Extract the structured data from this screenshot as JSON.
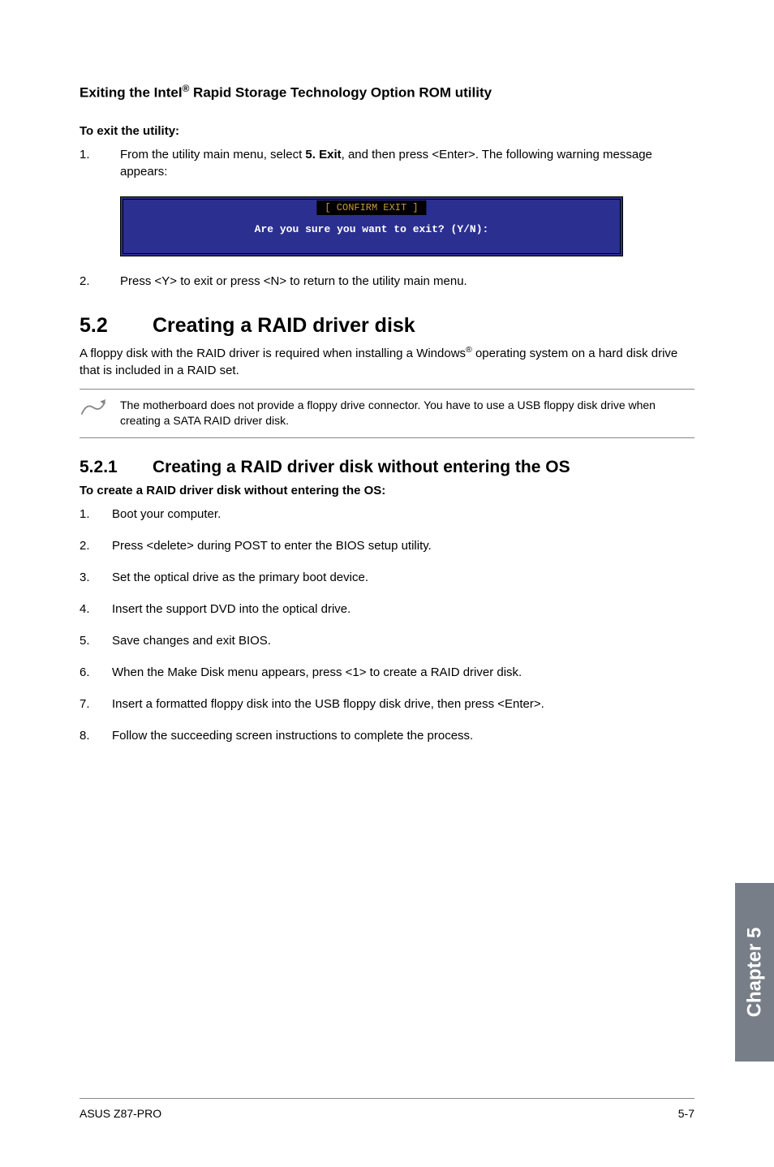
{
  "section1": {
    "heading": "Exiting the Intel",
    "heading_sup": "®",
    "heading_cont": " Rapid Storage Technology Option ROM utility",
    "sub": "To exit the utility:",
    "step1_num": "1.",
    "step1_a": "From the utility main menu, select ",
    "step1_b": "5. Exit",
    "step1_c": ", and then press <Enter>. The following warning message appears:",
    "terminal_header": "[ CONFIRM EXIT ]",
    "terminal_line": "Are you sure you want to exit? (Y/N):",
    "step2_num": "2.",
    "step2": "Press <Y> to exit or press <N> to return to the utility main menu."
  },
  "section2": {
    "num": "5.2",
    "title": "Creating a RAID driver disk",
    "para_a": "A floppy disk with the RAID driver is required when installing a Windows",
    "para_sup": "®",
    "para_b": " operating system on a hard disk drive that is included in a RAID set.",
    "note": "The motherboard does not provide a floppy drive connector. You have to use a USB floppy disk drive when creating a SATA RAID driver disk."
  },
  "section3": {
    "num": "5.2.1",
    "title": "Creating a RAID driver disk without entering the OS",
    "sub": "To create a RAID driver disk without entering the OS:",
    "items": [
      {
        "n": "1.",
        "t": "Boot your computer."
      },
      {
        "n": "2.",
        "t": "Press <delete> during POST to enter the BIOS setup utility."
      },
      {
        "n": "3.",
        "t": "Set the optical drive as the primary boot device."
      },
      {
        "n": "4.",
        "t": "Insert the support DVD into the optical drive."
      },
      {
        "n": "5.",
        "t": "Save changes and exit BIOS."
      },
      {
        "n": "6.",
        "t": "When the Make Disk menu appears, press <1> to create a RAID driver disk."
      },
      {
        "n": "7.",
        "t": "Insert a formatted floppy disk into the USB floppy disk drive, then press <Enter>."
      },
      {
        "n": "8.",
        "t": "Follow the succeeding screen instructions to complete the process."
      }
    ]
  },
  "chapterTab": "Chapter 5",
  "footer": {
    "left": "ASUS Z87-PRO",
    "right": "5-7"
  }
}
